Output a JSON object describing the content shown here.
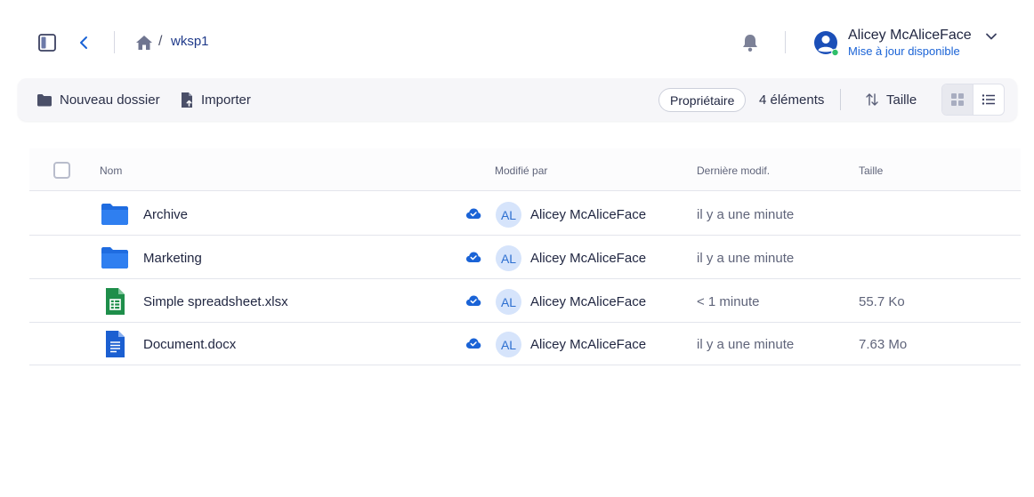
{
  "header": {
    "breadcrumb": {
      "separator": "/",
      "current": "wksp1"
    },
    "user": {
      "name": "Alicey McAliceFace",
      "update_text": "Mise à jour disponible"
    }
  },
  "toolbar": {
    "new_folder_label": "Nouveau dossier",
    "import_label": "Importer",
    "owner_label": "Propriétaire",
    "items_count": "4 éléments",
    "sort_label": "Taille"
  },
  "table": {
    "headers": {
      "name": "Nom",
      "modified_by": "Modifié par",
      "last_modified": "Dernière modif.",
      "size": "Taille"
    },
    "rows": [
      {
        "type": "folder",
        "icon": "folder-icon",
        "name": "Archive",
        "user_initials": "AL",
        "user_name": "Alicey McAliceFace",
        "modified": "il y a une minute",
        "size": ""
      },
      {
        "type": "folder",
        "icon": "folder-icon",
        "name": "Marketing",
        "user_initials": "AL",
        "user_name": "Alicey McAliceFace",
        "modified": "il y a une minute",
        "size": ""
      },
      {
        "type": "spreadsheet",
        "icon": "spreadsheet-icon",
        "name": "Simple spreadsheet.xlsx",
        "user_initials": "AL",
        "user_name": "Alicey McAliceFace",
        "modified": "< 1 minute",
        "size": "55.7 Ko"
      },
      {
        "type": "document",
        "icon": "document-icon",
        "name": "Document.docx",
        "user_initials": "AL",
        "user_name": "Alicey McAliceFace",
        "modified": "il y a une minute",
        "size": "7.63 Mo"
      }
    ]
  },
  "colors": {
    "accent": "#1a63d6",
    "folder": "#1f6ce0",
    "spreadsheet": "#1e8e4a",
    "document": "#1b5fd1",
    "status_online": "#2fbf6a"
  }
}
